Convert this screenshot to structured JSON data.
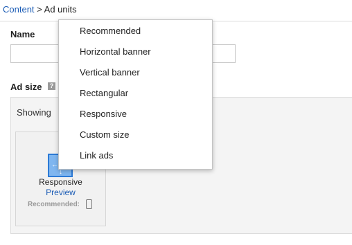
{
  "breadcrumb": {
    "link": "Content",
    "separator": ">",
    "current": "Ad units"
  },
  "form": {
    "name_label": "Name",
    "name_value": "",
    "adsize_label": "Ad size",
    "help_glyph": "?"
  },
  "panel": {
    "showing": "Showing"
  },
  "card": {
    "title": "Responsive",
    "preview": "Preview",
    "recommended": "Recommended:",
    "thumb_left": "←",
    "thumb_down": "↓"
  },
  "dropdown": {
    "items": [
      {
        "label": "Recommended"
      },
      {
        "label": "Horizontal banner"
      },
      {
        "label": "Vertical banner"
      },
      {
        "label": "Rectangular"
      },
      {
        "label": "Responsive"
      },
      {
        "label": "Custom size"
      },
      {
        "label": "Link ads"
      }
    ]
  },
  "colors": {
    "link": "#1a5bb5",
    "thumb_fill": "#7fb6f0",
    "thumb_border": "#2c7ad6"
  }
}
